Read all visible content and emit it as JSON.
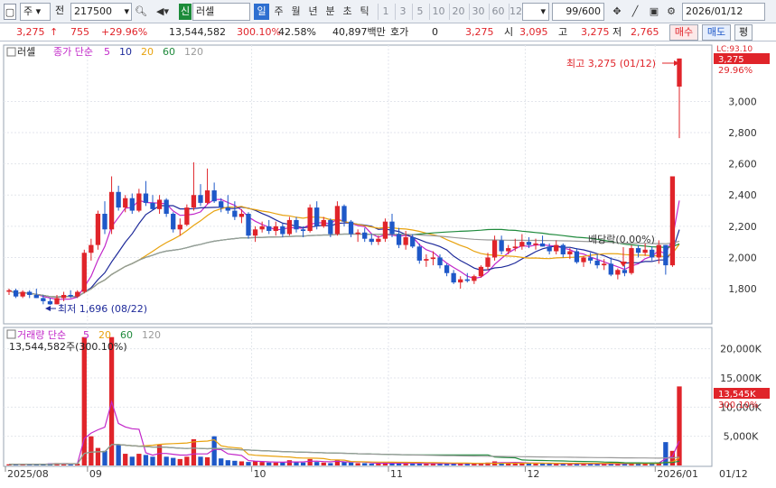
{
  "toolbar": {
    "market": "주",
    "prefix": "전",
    "code": "217500",
    "badge": "신",
    "name": "러셀",
    "periods": [
      "일",
      "주",
      "월",
      "년",
      "분",
      "초",
      "틱"
    ],
    "active_period": "일",
    "intervals": [
      "1",
      "3",
      "5",
      "10",
      "20",
      "30",
      "60",
      "120"
    ],
    "count": "99/600",
    "date": "2026/01/12"
  },
  "info": {
    "price": "3,275",
    "arrow": "↑",
    "change": "755",
    "change_pct": "+29.96%",
    "volume": "13,544,582",
    "volume_ratio": "300.10%",
    "turnover": "42.58%",
    "amount": "40,897백만",
    "hoga_label": "호가",
    "hoga_value": "0",
    "hoga_price": "3,275",
    "open_label": "시",
    "open": "3,095",
    "high_label": "고",
    "high": "3,275",
    "low_label": "저",
    "low": "2,765",
    "buy_button": "매수",
    "sell_button": "매도",
    "eval_button": "평"
  },
  "price_panel": {
    "legend_name": "러셀",
    "legend_ma_label": "종가 단순",
    "ma_periods": [
      "5",
      "10",
      "20",
      "60",
      "120"
    ],
    "ma_colors": [
      "#c227c9",
      "#1e2a9a",
      "#e8a20e",
      "#1f8a3c",
      "#9a9a9a"
    ],
    "y_ticks": [
      "3,000",
      "2,800",
      "2,600",
      "2,400",
      "2,200",
      "2,000",
      "1,800"
    ],
    "top_ticker": "LC:93.10",
    "last_price_tag": "3,275",
    "last_pct_tag": "29.96%",
    "annotation_high": "최고 3,275 (01/12)",
    "annotation_low": "최저 1,696 (08/22)",
    "annotation_dividend": "배당락(0.00%)"
  },
  "volume_panel": {
    "legend_label": "거래량 단순",
    "ma_periods": [
      "5",
      "20",
      "60",
      "120"
    ],
    "ma_colors": [
      "#c227c9",
      "#e8a20e",
      "#1f8a3c",
      "#9a9a9a"
    ],
    "summary": "13,544,582주(300.10%)",
    "y_ticks": [
      "20,000K",
      "15,000K",
      "10,000K",
      "5,000K"
    ],
    "last_vol_tag": "13,545K",
    "last_pct_tag": "300.10%"
  },
  "x_axis": {
    "labels": [
      "2025/08",
      "09",
      "10",
      "11",
      "12",
      "2026/01"
    ],
    "right_label": "01/12"
  },
  "chart_data": {
    "type": "candlestick",
    "y_unit": "KRW",
    "ylim": [
      1650,
      3280
    ],
    "volume_ylim": [
      0,
      23500
    ],
    "volume_unit": "K shares",
    "candles": [
      [
        1780,
        1800,
        1760,
        1790,
        200
      ],
      [
        1790,
        1800,
        1740,
        1750,
        150
      ],
      [
        1750,
        1790,
        1740,
        1780,
        180
      ],
      [
        1780,
        1790,
        1740,
        1760,
        160
      ],
      [
        1760,
        1800,
        1740,
        1740,
        220
      ],
      [
        1740,
        1760,
        1700,
        1720,
        300
      ],
      [
        1720,
        1740,
        1696,
        1700,
        350
      ],
      [
        1700,
        1760,
        1700,
        1740,
        400
      ],
      [
        1740,
        1780,
        1720,
        1760,
        250
      ],
      [
        1760,
        1790,
        1740,
        1750,
        200
      ],
      [
        1750,
        1790,
        1740,
        1780,
        300
      ],
      [
        1780,
        2050,
        1770,
        2030,
        22000
      ],
      [
        2030,
        2120,
        1980,
        2080,
        5000
      ],
      [
        2080,
        2300,
        2050,
        2280,
        3000
      ],
      [
        2280,
        2360,
        2150,
        2180,
        2500
      ],
      [
        2180,
        2520,
        2150,
        2420,
        22000
      ],
      [
        2420,
        2460,
        2300,
        2320,
        3500
      ],
      [
        2320,
        2400,
        2290,
        2380,
        2000
      ],
      [
        2380,
        2410,
        2280,
        2300,
        1500
      ],
      [
        2300,
        2440,
        2290,
        2410,
        2000
      ],
      [
        2410,
        2490,
        2330,
        2350,
        1800
      ],
      [
        2350,
        2400,
        2300,
        2310,
        1500
      ],
      [
        2310,
        2400,
        2280,
        2370,
        3500
      ],
      [
        2370,
        2380,
        2260,
        2280,
        1500
      ],
      [
        2280,
        2290,
        2160,
        2180,
        1300
      ],
      [
        2180,
        2250,
        2140,
        2210,
        1100
      ],
      [
        2210,
        2340,
        2200,
        2320,
        1500
      ],
      [
        2320,
        2610,
        2300,
        2400,
        4500
      ],
      [
        2400,
        2470,
        2330,
        2350,
        1500
      ],
      [
        2350,
        2570,
        2340,
        2430,
        1400
      ],
      [
        2430,
        2480,
        2350,
        2360,
        5000
      ],
      [
        2360,
        2380,
        2290,
        2320,
        1200
      ],
      [
        2320,
        2400,
        2280,
        2300,
        900
      ],
      [
        2300,
        2360,
        2240,
        2260,
        800
      ],
      [
        2260,
        2310,
        2220,
        2280,
        700
      ],
      [
        2280,
        2290,
        2120,
        2140,
        600
      ],
      [
        2140,
        2200,
        2100,
        2180,
        700
      ],
      [
        2180,
        2230,
        2160,
        2200,
        600
      ],
      [
        2200,
        2240,
        2150,
        2170,
        500
      ],
      [
        2170,
        2230,
        2140,
        2200,
        500
      ],
      [
        2200,
        2220,
        2130,
        2150,
        500
      ],
      [
        2150,
        2260,
        2140,
        2240,
        900
      ],
      [
        2240,
        2260,
        2160,
        2180,
        600
      ],
      [
        2180,
        2200,
        2130,
        2170,
        500
      ],
      [
        2170,
        2340,
        2160,
        2320,
        1100
      ],
      [
        2320,
        2360,
        2180,
        2200,
        600
      ],
      [
        2200,
        2260,
        2190,
        2240,
        500
      ],
      [
        2240,
        2250,
        2130,
        2150,
        400
      ],
      [
        2150,
        2360,
        2140,
        2330,
        1000
      ],
      [
        2330,
        2340,
        2200,
        2230,
        600
      ],
      [
        2230,
        2240,
        2130,
        2150,
        500
      ],
      [
        2150,
        2180,
        2100,
        2160,
        400
      ],
      [
        2160,
        2190,
        2100,
        2120,
        400
      ],
      [
        2120,
        2150,
        2080,
        2100,
        300
      ],
      [
        2100,
        2140,
        2080,
        2120,
        300
      ],
      [
        2120,
        2250,
        2100,
        2230,
        500
      ],
      [
        2230,
        2280,
        2130,
        2150,
        400
      ],
      [
        2150,
        2190,
        2060,
        2080,
        400
      ],
      [
        2080,
        2170,
        2050,
        2130,
        300
      ],
      [
        2130,
        2150,
        2060,
        2070,
        300
      ],
      [
        2070,
        2090,
        1960,
        1980,
        400
      ],
      [
        1980,
        2020,
        1940,
        1990,
        300
      ],
      [
        1990,
        2040,
        1950,
        2000,
        300
      ],
      [
        2000,
        2020,
        1930,
        1950,
        300
      ],
      [
        1950,
        1960,
        1880,
        1900,
        400
      ],
      [
        1900,
        1920,
        1830,
        1840,
        300
      ],
      [
        1840,
        1880,
        1800,
        1860,
        300
      ],
      [
        1860,
        1900,
        1840,
        1850,
        300
      ],
      [
        1850,
        1890,
        1830,
        1880,
        300
      ],
      [
        1880,
        1950,
        1870,
        1940,
        400
      ],
      [
        1940,
        2030,
        1920,
        2000,
        500
      ],
      [
        2000,
        2140,
        1980,
        2110,
        700
      ],
      [
        2110,
        2140,
        2020,
        2040,
        500
      ],
      [
        2040,
        2080,
        2020,
        2060,
        400
      ],
      [
        2060,
        2120,
        2040,
        2070,
        500
      ],
      [
        2070,
        2150,
        2050,
        2100,
        400
      ],
      [
        2100,
        2130,
        2060,
        2080,
        400
      ],
      [
        2080,
        2120,
        2050,
        2090,
        300
      ],
      [
        2090,
        2140,
        2070,
        2070,
        300
      ],
      [
        2070,
        2090,
        2020,
        2040,
        300
      ],
      [
        2040,
        2110,
        2020,
        2080,
        300
      ],
      [
        2080,
        2090,
        2000,
        2020,
        300
      ],
      [
        2020,
        2060,
        1990,
        2040,
        300
      ],
      [
        2040,
        2060,
        1960,
        1970,
        300
      ],
      [
        1970,
        2010,
        1940,
        2000,
        300
      ],
      [
        2000,
        2030,
        1960,
        1980,
        300
      ],
      [
        1980,
        2020,
        1930,
        1950,
        300
      ],
      [
        1950,
        1990,
        1920,
        1960,
        300
      ],
      [
        1960,
        2000,
        1880,
        1890,
        300
      ],
      [
        1890,
        1930,
        1860,
        1920,
        300
      ],
      [
        1920,
        1950,
        1880,
        1900,
        300
      ],
      [
        1900,
        2080,
        1890,
        2060,
        400
      ],
      [
        2060,
        2080,
        2000,
        2030,
        400
      ],
      [
        2030,
        2090,
        2010,
        2050,
        400
      ],
      [
        2050,
        2070,
        1980,
        2000,
        400
      ],
      [
        2000,
        2110,
        1960,
        2080,
        500
      ],
      [
        2080,
        2080,
        1890,
        1950,
        4000
      ],
      [
        1950,
        2520,
        1940,
        2520,
        2500
      ],
      [
        3095,
        3275,
        2765,
        3275,
        13545
      ]
    ]
  }
}
